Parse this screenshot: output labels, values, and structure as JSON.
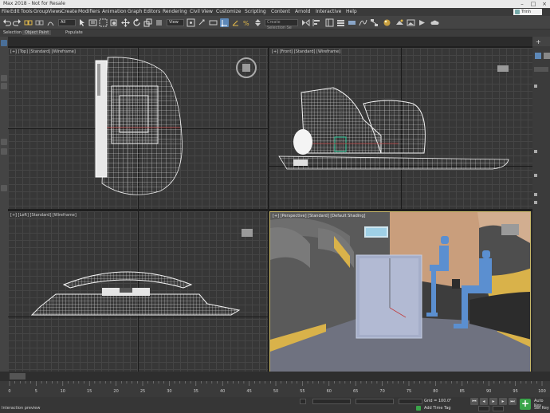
{
  "window": {
    "title": "Max 2018 - Not for Resale"
  },
  "menu": {
    "items": [
      "File",
      "Edit",
      "Tools",
      "Group",
      "Views",
      "Create",
      "Modifiers",
      "Animation",
      "Graph Editors",
      "Rendering",
      "Civil View",
      "Customize",
      "Scripting",
      "Content",
      "Arnold",
      "Interactive",
      "Help"
    ],
    "user": "Trinh Banh"
  },
  "toolbar": {
    "filter_value": "All",
    "view_value": "View",
    "selection_set_placeholder": "Create Selection Se"
  },
  "ribbon": {
    "tabs": [
      "Selection",
      "Object Paint",
      "Populate"
    ]
  },
  "viewports": {
    "top": {
      "label": "[+] [Top] [Standard] [Wireframe]"
    },
    "front": {
      "label": "[+] [Front] [Standard] [Wireframe]"
    },
    "left": {
      "label": "[+] [Left] [Standard] [Wireframe]"
    },
    "perspective": {
      "label": "[+] [Perspective] [Standard] [Default Shading]"
    }
  },
  "timeline": {
    "ticks": [
      "0",
      "5",
      "10",
      "15",
      "20",
      "25",
      "30",
      "35",
      "40",
      "45",
      "50",
      "55",
      "60",
      "65",
      "70",
      "75",
      "80",
      "85",
      "90",
      "95",
      "100"
    ]
  },
  "status": {
    "prompt": "Interaction preview",
    "grid": "Grid = 100.0\"",
    "add_time_tag": "Add Time Tag",
    "auto_key": "Auto Key",
    "set_key": "Set Key"
  },
  "colors": {
    "accent": "#5d88b8",
    "viewport_bg": "#373737",
    "perspective_wall": "#a5aec9",
    "figure_blue": "#5b8fd0",
    "bench_yellow": "#d9b24a",
    "floor": "#6f7280",
    "add_button": "#3aa54a"
  }
}
